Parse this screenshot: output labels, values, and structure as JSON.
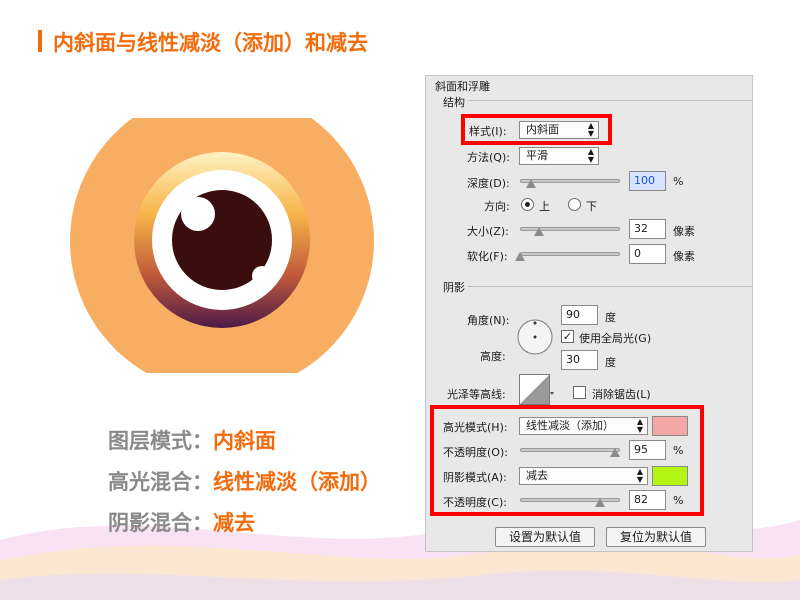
{
  "slide": {
    "title": "内斜面与线性减淡（添加）和减去"
  },
  "captions": [
    {
      "label": "图层模式：",
      "value": "内斜面"
    },
    {
      "label": "高光混合：",
      "value": "线性减淡（添加）"
    },
    {
      "label": "阴影混合：",
      "value": "减去"
    }
  ],
  "panel": {
    "title": "斜面和浮雕",
    "structure": {
      "heading": "结构",
      "style_label": "样式(I):",
      "style_value": "内斜面",
      "technique_label": "方法(Q):",
      "technique_value": "平滑",
      "depth_label": "深度(D):",
      "depth_value": "100",
      "depth_unit": "%",
      "direction_label": "方向:",
      "direction_up": "上",
      "direction_down": "下",
      "size_label": "大小(Z):",
      "size_value": "32",
      "size_unit": "像素",
      "soften_label": "软化(F):",
      "soften_value": "0",
      "soften_unit": "像素"
    },
    "shading": {
      "heading": "阴影",
      "angle_label": "角度(N):",
      "angle_value": "90",
      "angle_unit": "度",
      "global_light_label": "使用全局光(G)",
      "altitude_label": "高度:",
      "altitude_value": "30",
      "altitude_unit": "度",
      "gloss_contour_label": "光泽等高线:",
      "anti_aliased_label": "消除锯齿(L)",
      "highlight_mode_label": "高光模式(H):",
      "highlight_mode_value": "线性减淡（添加）",
      "highlight_color": "#f4a7a7",
      "highlight_opacity_label": "不透明度(O):",
      "highlight_opacity_value": "95",
      "highlight_opacity_unit": "%",
      "shadow_mode_label": "阴影模式(A):",
      "shadow_mode_value": "减去",
      "shadow_color": "#b5f516",
      "shadow_opacity_label": "不透明度(C):",
      "shadow_opacity_value": "82",
      "shadow_opacity_unit": "%"
    },
    "buttons": {
      "make_default": "设置为默认值",
      "reset_default": "复位为默认值"
    }
  },
  "colors": {
    "accent": "#f26c0d",
    "caption_label": "#8a8a8a",
    "eye_outer": "#f8ae62",
    "ring_top": "#ffe9a8",
    "ring_bottom": "#5d2046",
    "pupil": "#3a0e0e",
    "highlight_frame": "#ff0000"
  },
  "icons": {
    "title_bar": "vertical-bar",
    "dropdown": "up-down-chevrons",
    "angle": "angle-dial",
    "contour": "contour-curve"
  }
}
